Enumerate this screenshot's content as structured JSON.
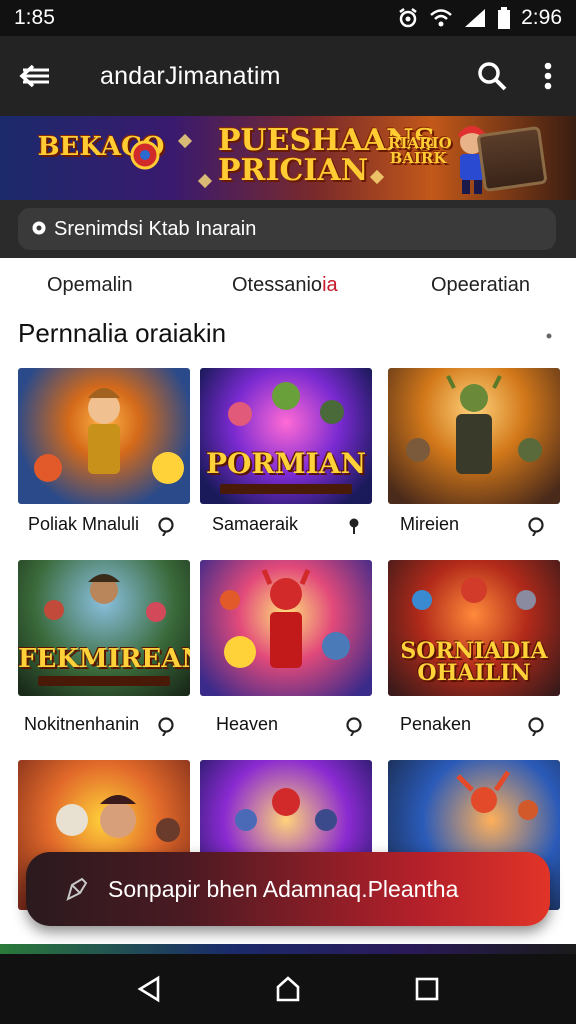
{
  "status_bar": {
    "time": "1:85",
    "time_right": "2:96"
  },
  "app_bar": {
    "title": "andarJimanatim",
    "icons": [
      "back-arrow-icon",
      "search-icon",
      "more-vert-icon"
    ]
  },
  "banner": {
    "title_left": "BEKACO",
    "title_center": "PUESHAANS PRICIAN",
    "title_right": "RIARIO BAIRK"
  },
  "search": {
    "placeholder": "Srenimdsi Ktab Inarain"
  },
  "tabs": {
    "tab1": "Opemalin",
    "tab2_main": "Otessanio",
    "tab2_accent": "ia",
    "tab3": "Opeeratian"
  },
  "section": {
    "title": "Pernnalia oraiakin"
  },
  "grid": {
    "r1": [
      {
        "label": "Poliak Mnaluli",
        "art": ""
      },
      {
        "label": "Samaeraik",
        "art": "PORMIAN"
      },
      {
        "label": "Mireien",
        "art": ""
      }
    ],
    "r2": [
      {
        "label": "Nokitnenhanin",
        "art": "FEKMIREAN"
      },
      {
        "label": "Heaven",
        "art": ""
      },
      {
        "label": "Penaken",
        "art": "SORNIADIA OHAILIN"
      }
    ]
  },
  "toast": {
    "text": "Sonpapir bhen Adamnaq.Pleantha"
  },
  "nav": {
    "icons": [
      "back-triangle-icon",
      "home-icon",
      "recents-icon"
    ]
  }
}
